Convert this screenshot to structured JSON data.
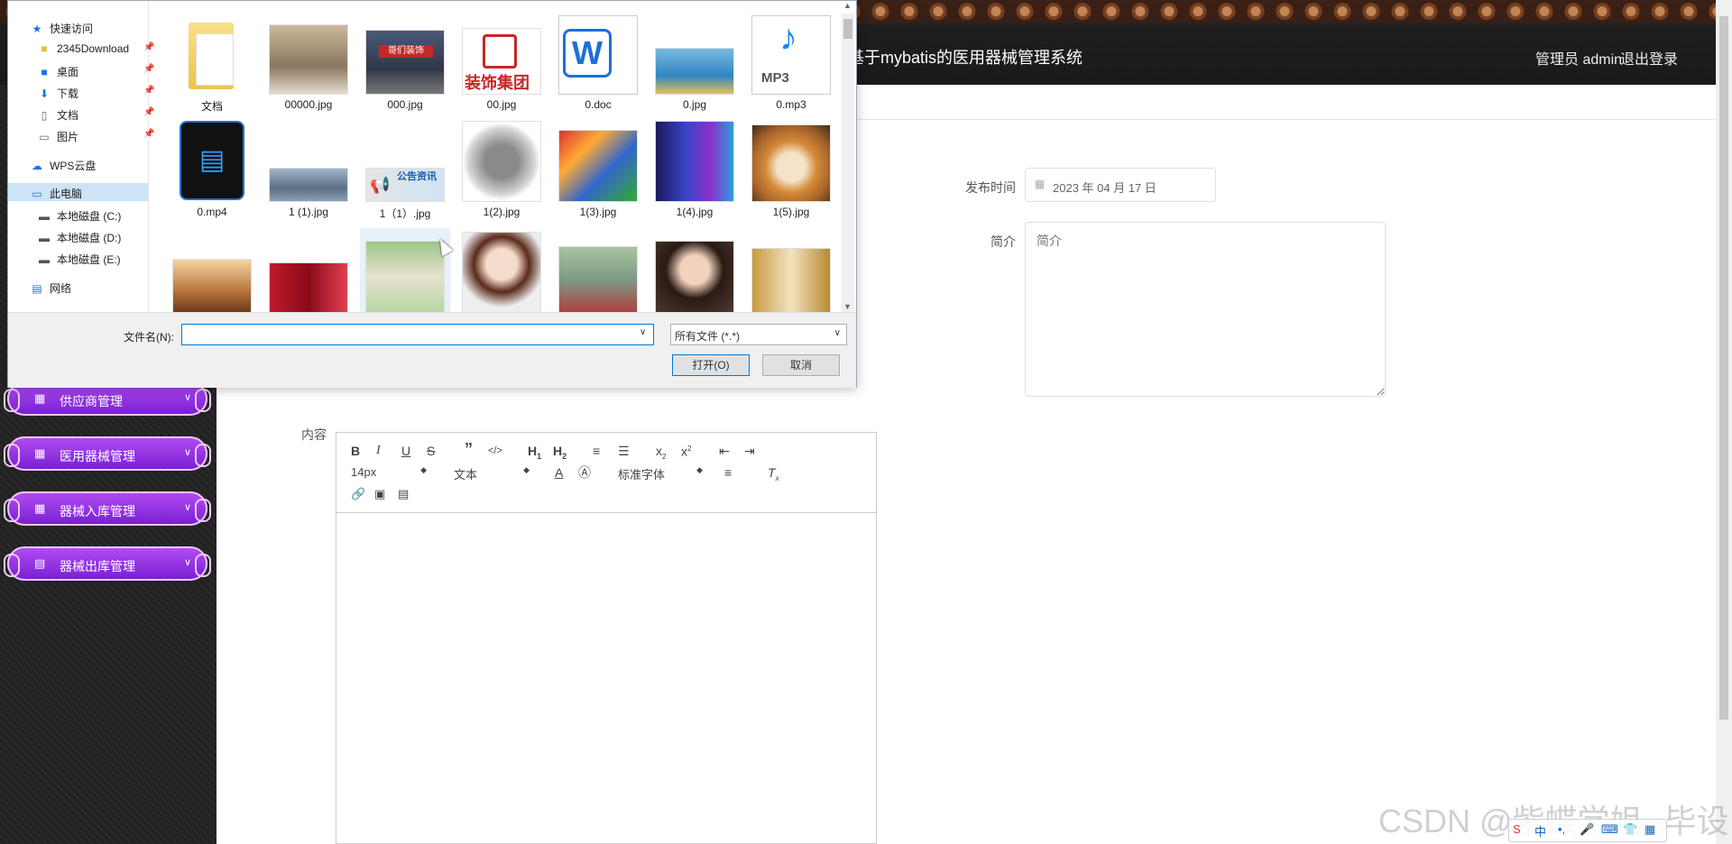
{
  "header": {
    "title": "基于mybatis的医用器械管理系统",
    "user": "管理员 admin",
    "logout": "退出登录"
  },
  "sidebar": {
    "items": [
      {
        "label": "供应商管理",
        "icon": "grid-icon"
      },
      {
        "label": "医用器械管理",
        "icon": "grid-icon"
      },
      {
        "label": "器械入库管理",
        "icon": "grid-icon"
      },
      {
        "label": "器械出库管理",
        "icon": "box-icon"
      }
    ]
  },
  "form": {
    "date_label": "发布时间",
    "date_value": "2023 年 04 月 17 日",
    "intro_label": "简介",
    "intro_placeholder": "简介",
    "content_label": "内容"
  },
  "editor": {
    "font_size": "14px",
    "format": "文本",
    "font_family": "标准字体"
  },
  "file_dialog": {
    "nav": {
      "quick_access": "快速访问",
      "items": [
        "2345Download",
        "桌面",
        "下载",
        "文档",
        "图片"
      ],
      "wps": "WPS云盘",
      "this_pc": "此电脑",
      "drives": [
        "本地磁盘 (C:)",
        "本地磁盘 (D:)",
        "本地磁盘 (E:)"
      ],
      "network": "网络"
    },
    "files_row1": [
      "文档",
      "00000.jpg",
      "000.jpg",
      "00.jpg",
      "0.doc",
      "0.jpg",
      "0.mp3"
    ],
    "files_row2": [
      "0.mp4",
      "1 (1).jpg",
      "1（1）.jpg",
      "1(2).jpg",
      "1(3).jpg",
      "1(4).jpg",
      "1(5).jpg"
    ],
    "thumb_texts": {
      "sign_shop": "哥们装饰",
      "banner_company": "装饰集团",
      "notice": "公告资讯",
      "mp3": "MP3",
      "doc": "W"
    },
    "filename_label": "文件名(N):",
    "filename_value": "",
    "filetype": "所有文件 (*.*)",
    "open": "打开(O)",
    "cancel": "取消"
  },
  "watermark": "CSDN @紫蝶学姐--毕设"
}
